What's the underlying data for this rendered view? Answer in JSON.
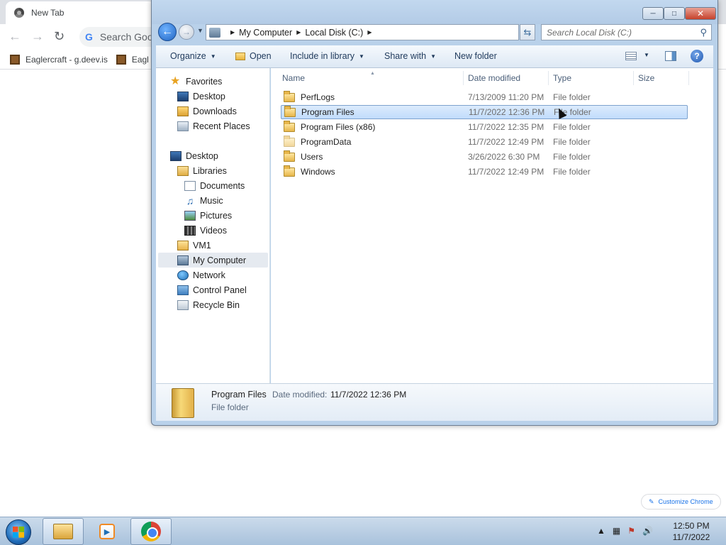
{
  "browser": {
    "tab_title": "New Tab",
    "omnibox_placeholder": "Search Goo",
    "bookmarks": [
      "Eaglercraft - g.deev.is",
      "Eagl"
    ],
    "customize_label": "Customize Chrome"
  },
  "window": {
    "address": {
      "crumbs": [
        "My Computer",
        "Local Disk (C:)"
      ]
    },
    "search_placeholder": "Search Local Disk (C:)",
    "toolbar": {
      "organize": "Organize",
      "open": "Open",
      "include_in_library": "Include in library",
      "share_with": "Share with",
      "new_folder": "New folder"
    },
    "nav": {
      "favorites": "Favorites",
      "desktop_fav": "Desktop",
      "downloads": "Downloads",
      "recent_places": "Recent Places",
      "desktop": "Desktop",
      "libraries": "Libraries",
      "documents": "Documents",
      "music": "Music",
      "pictures": "Pictures",
      "videos": "Videos",
      "vm1": "VM1",
      "my_computer": "My Computer",
      "network": "Network",
      "control_panel": "Control Panel",
      "recycle_bin": "Recycle Bin"
    },
    "columns": {
      "name": "Name",
      "date_modified": "Date modified",
      "type": "Type",
      "size": "Size"
    },
    "files": [
      {
        "name": "PerfLogs",
        "date": "7/13/2009 11:20 PM",
        "type": "File folder"
      },
      {
        "name": "Program Files",
        "date": "11/7/2022 12:36 PM",
        "type": "File folder",
        "selected": true
      },
      {
        "name": "Program Files (x86)",
        "date": "11/7/2022 12:35 PM",
        "type": "File folder"
      },
      {
        "name": "ProgramData",
        "date": "11/7/2022 12:49 PM",
        "type": "File folder"
      },
      {
        "name": "Users",
        "date": "3/26/2022 6:30 PM",
        "type": "File folder"
      },
      {
        "name": "Windows",
        "date": "11/7/2022 12:49 PM",
        "type": "File folder"
      }
    ],
    "details": {
      "name": "Program Files",
      "modified_label": "Date modified:",
      "modified_value": "11/7/2022 12:36 PM",
      "type": "File folder"
    }
  },
  "taskbar": {
    "time": "12:50 PM",
    "date": "11/7/2022"
  },
  "colors": {
    "window_frame": "#b9d1ea",
    "selection": "#c1dcfc",
    "taskbar": "#bcd0e6"
  }
}
